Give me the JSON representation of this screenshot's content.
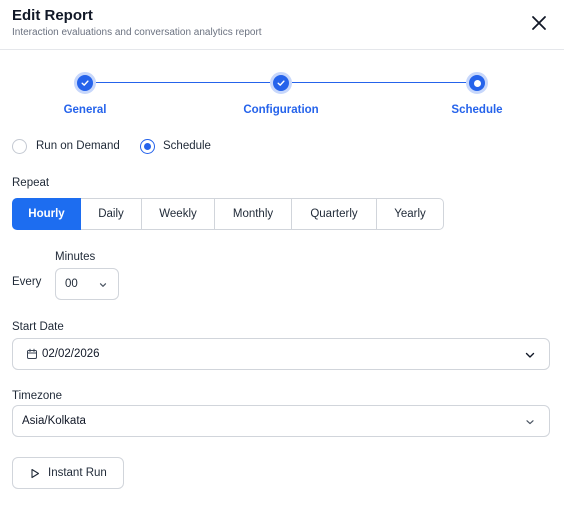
{
  "header": {
    "title": "Edit Report",
    "subtitle": "Interaction evaluations and conversation analytics report"
  },
  "stepper": {
    "steps": [
      {
        "label": "General",
        "state": "completed"
      },
      {
        "label": "Configuration",
        "state": "completed"
      },
      {
        "label": "Schedule",
        "state": "current"
      }
    ]
  },
  "run_mode": {
    "options": [
      "Run on Demand",
      "Schedule"
    ],
    "selected": "Schedule"
  },
  "repeat": {
    "label": "Repeat",
    "options": [
      "Hourly",
      "Daily",
      "Weekly",
      "Monthly",
      "Quarterly",
      "Yearly"
    ],
    "selected": "Hourly"
  },
  "every": {
    "label": "Every",
    "minutes_label": "Minutes",
    "minutes_value": "00"
  },
  "start_date": {
    "label": "Start Date",
    "value": "02/02/2026"
  },
  "timezone": {
    "label": "Timezone",
    "value": "Asia/Kolkata"
  },
  "instant_run": {
    "label": "Instant Run"
  },
  "colors": {
    "accent": "#2563eb",
    "active_segment": "#1d6df0",
    "border": "#d1d5db"
  }
}
